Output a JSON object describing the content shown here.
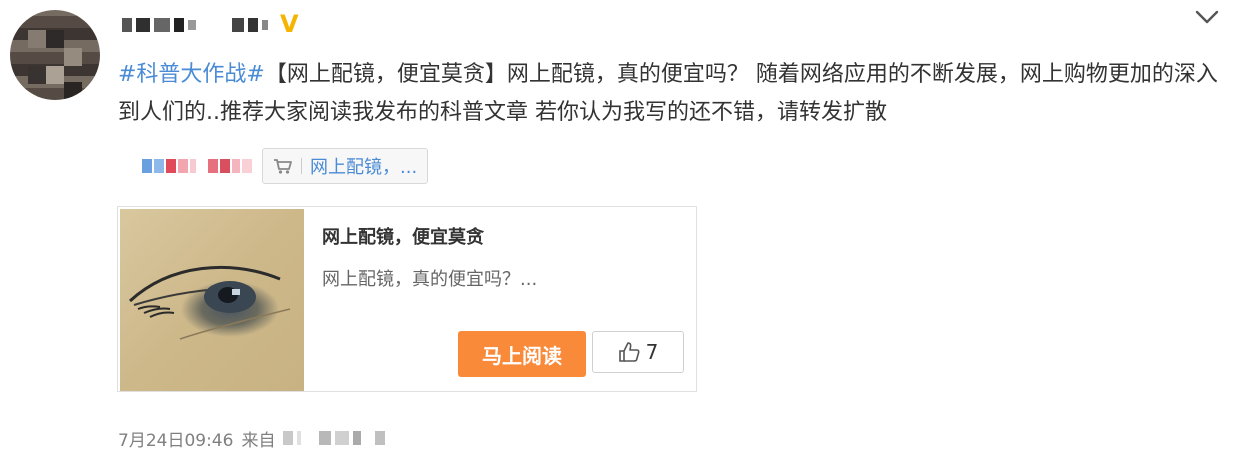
{
  "post": {
    "hashtag": "#科普大作战#",
    "text_after_hashtag": "【网上配镜，便宜莫贪】网上配镜，真的便宜吗？ 随着网络应用的不断发展，网上购物更加的深入到人们的..推荐大家阅读我发布的科普文章 若你认为我写的还不错，请转发扩散"
  },
  "product_link": {
    "label": "网上配镜，...",
    "icon": "cart-icon"
  },
  "card": {
    "title": "网上配镜，便宜莫贪",
    "description": "网上配镜，真的便宜吗？...",
    "read_button": "马上阅读",
    "like_count": "7",
    "like_icon": "thumbs-up-icon"
  },
  "footer": {
    "timestamp": "7月24日09:46",
    "from_label": "来自"
  },
  "header": {
    "verified_badge": "V",
    "menu_icon": "chevron-down-icon"
  },
  "colors": {
    "link": "#4a8bd6",
    "accent_button": "#f98a3a",
    "verified": "#f5b400"
  }
}
